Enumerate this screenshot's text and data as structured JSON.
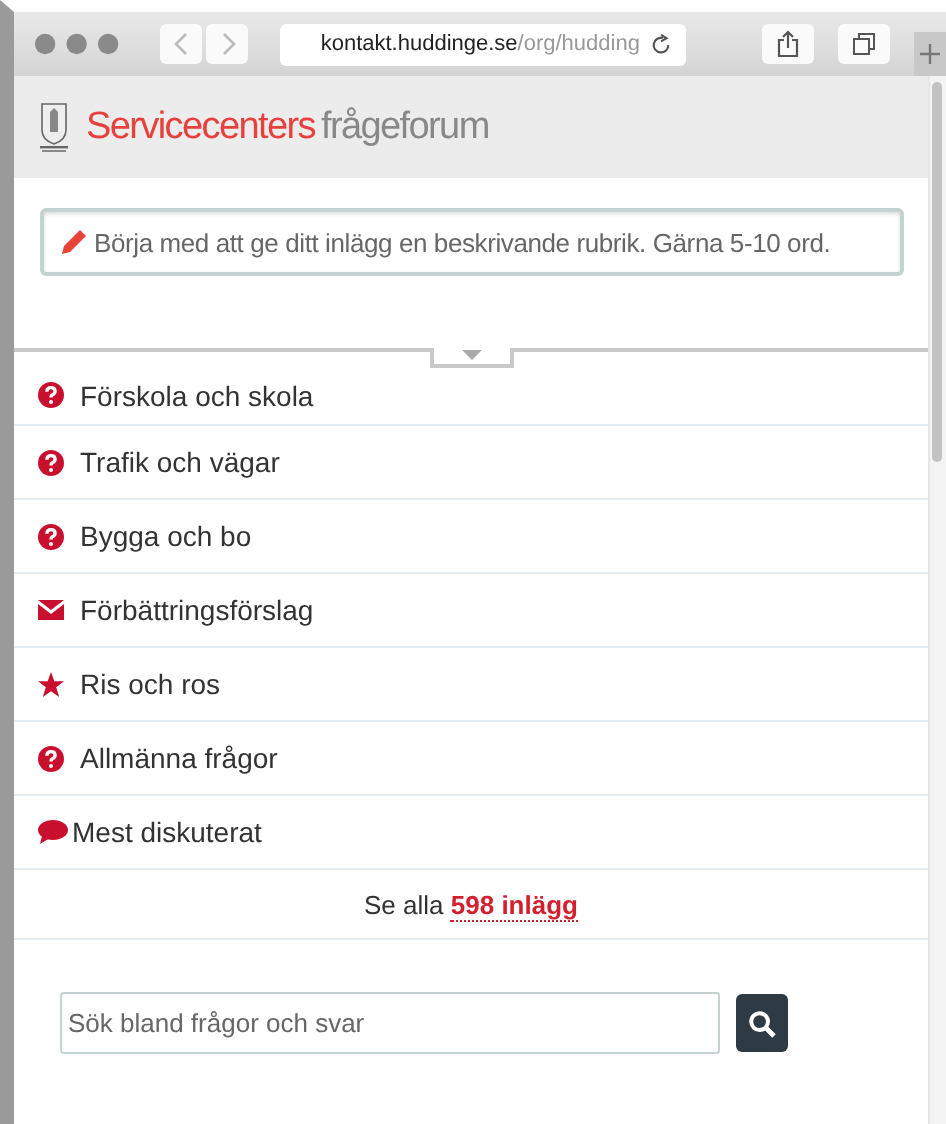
{
  "browser": {
    "url": "**kontakt.huddinge.se**/org/hudding"
  },
  "header": {
    "brand": "Servicecenters",
    "title": "frågeforum"
  },
  "compose": {
    "placeholder": "Börja med att ge ditt inlägg en beskrivande rubrik. Gärna 5-10 ord."
  },
  "categories": [
    {
      "kind": "question",
      "label": "Förskola och skola"
    },
    {
      "kind": "question",
      "label": "Trafik och vägar"
    },
    {
      "kind": "question",
      "label": "Bygga och bo"
    },
    {
      "kind": "envelope",
      "label": "Förbättringsförslag"
    },
    {
      "kind": "star",
      "label": "Ris och ros"
    },
    {
      "kind": "question",
      "label": "Allmänna frågor"
    },
    {
      "kind": "speech",
      "label": "Mest diskuterat"
    }
  ],
  "see_all": {
    "prefix": "Se alla",
    "link": "598 inlägg"
  },
  "search": {
    "placeholder": "Sök bland frågor och svar"
  }
}
